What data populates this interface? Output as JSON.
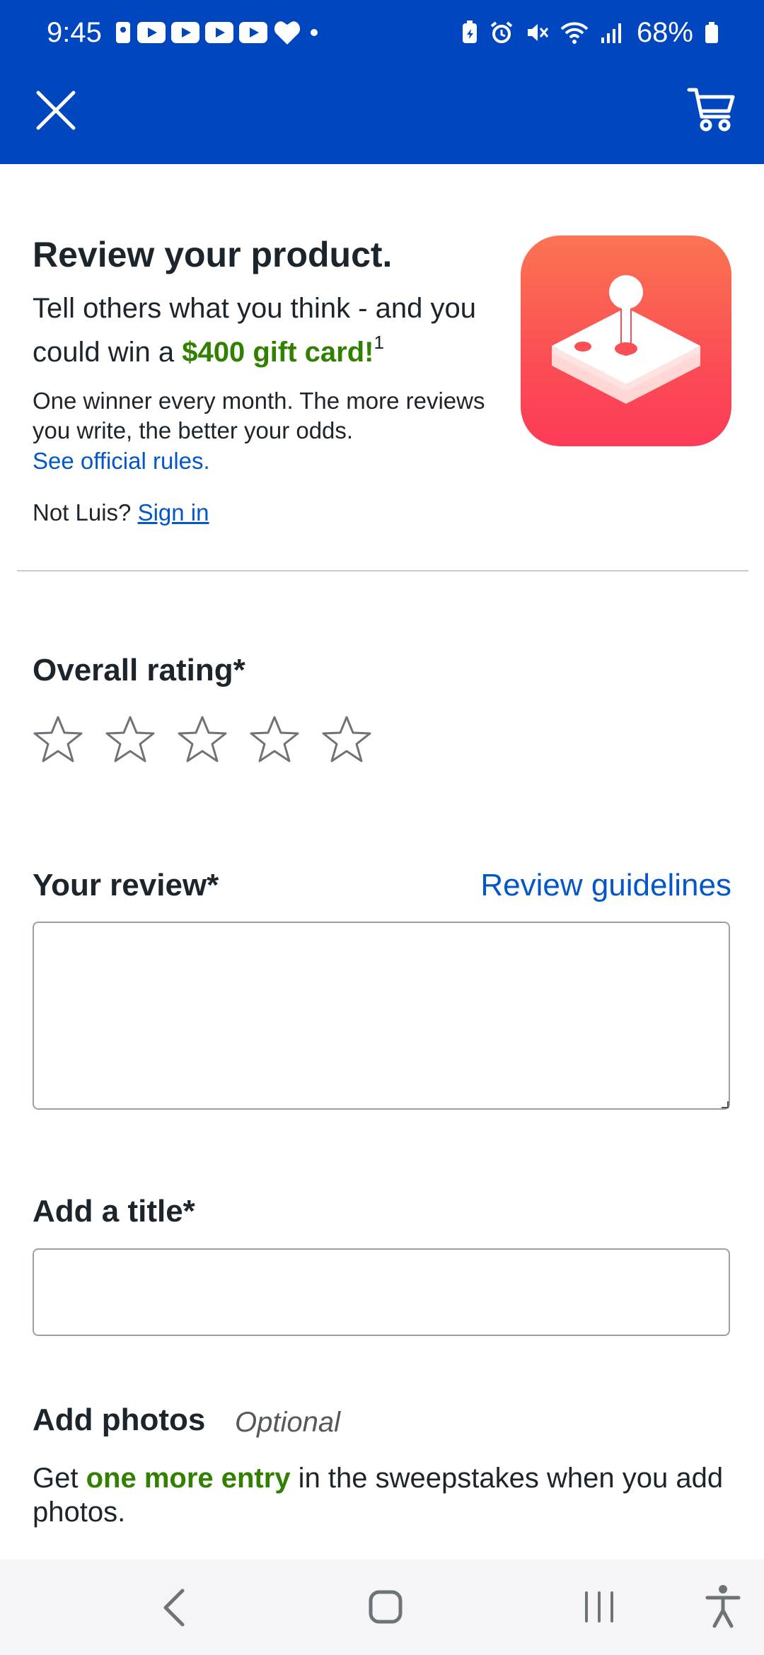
{
  "status_bar": {
    "time": "9:45",
    "battery": "68%"
  },
  "header": {
    "close_icon": "close-icon",
    "cart_icon": "cart-icon"
  },
  "intro": {
    "title": "Review your product.",
    "lead_prefix": "Tell others what you think - and you could win a ",
    "lead_highlight": "$400 gift card!",
    "lead_sup": "1",
    "small_text": "One winner every month. The more reviews you write, the better your odds.",
    "rules_link": "See official rules.",
    "not_user": "Not Luis?",
    "sign_in": "Sign in"
  },
  "rating": {
    "label": "Overall rating*",
    "stars_total": 5,
    "stars_selected": 0
  },
  "review": {
    "label": "Your review*",
    "guidelines_link": "Review guidelines",
    "value": ""
  },
  "title_field": {
    "label": "Add a title*",
    "value": ""
  },
  "photos": {
    "label": "Add photos",
    "optional": "Optional",
    "note_prefix": "Get ",
    "note_highlight": "one more entry",
    "note_suffix": " in the sweepstakes when you add photos."
  },
  "colors": {
    "header_bg": "#0046be",
    "link": "#0457c8",
    "promo_green": "#318000",
    "product_image": "#fb4d54"
  }
}
